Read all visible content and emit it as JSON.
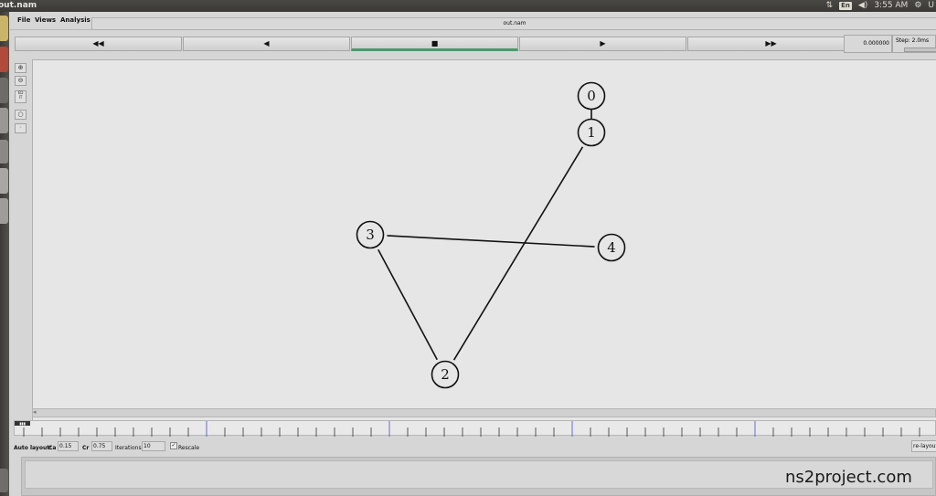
{
  "system_bar": {
    "window_title": "out.nam",
    "keyboard_layout": "En",
    "clock": "3:55 AM",
    "user_initial": "U"
  },
  "menu": {
    "file": "File",
    "views": "Views",
    "analysis": "Analysis"
  },
  "filename": "out.nam",
  "controls": {
    "rewind": "◀◀",
    "back": "◀",
    "stop": "■",
    "play": "▶",
    "fast_forward": "▶▶",
    "active": "stop"
  },
  "time_display": "0.000000",
  "step_label": "Step: 2.0ms",
  "tools": {
    "edit_label": "ED\nIT"
  },
  "network": {
    "nodes": [
      {
        "id": "0",
        "label": "0"
      },
      {
        "id": "1",
        "label": "1"
      },
      {
        "id": "2",
        "label": "2"
      },
      {
        "id": "3",
        "label": "3"
      },
      {
        "id": "4",
        "label": "4"
      }
    ],
    "links": [
      {
        "from": "0",
        "to": "1"
      },
      {
        "from": "1",
        "to": "2"
      },
      {
        "from": "2",
        "to": "3"
      },
      {
        "from": "3",
        "to": "4"
      }
    ]
  },
  "auto_layout": {
    "label": "Auto layout:",
    "ca_label": "Ca",
    "ca_value": "0.15",
    "cr_label": "Cr",
    "cr_value": "0.75",
    "iterations_label": "Iterations",
    "iterations_value": "10",
    "rescale_label": "Rescale",
    "rescale_checked": true,
    "relayout_label": "re-layout"
  },
  "watermark": "ns2project.com"
}
